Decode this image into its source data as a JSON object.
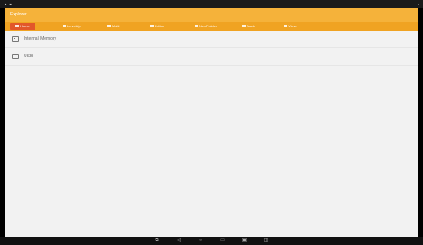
{
  "status": {
    "left_icons": "■ ■",
    "right_text": "▪"
  },
  "app": {
    "title": "Explorer"
  },
  "toolbar": {
    "items": [
      {
        "label": "Home",
        "icon": "home-icon"
      },
      {
        "label": "LevelUp",
        "icon": "levelup-icon"
      },
      {
        "label": "Multi",
        "icon": "multi-icon"
      },
      {
        "label": "Editor",
        "icon": "editor-icon"
      },
      {
        "label": "NewFolder",
        "icon": "newfolder-icon"
      },
      {
        "label": "Back",
        "icon": "back-icon"
      },
      {
        "label": "View",
        "icon": "view-icon"
      }
    ]
  },
  "list": {
    "items": [
      {
        "label": "Internal Memory",
        "icon": "disk-icon"
      },
      {
        "label": "USB",
        "icon": "usb-icon"
      }
    ]
  },
  "nav": {
    "buttons": [
      {
        "glyph": "⧉",
        "icon": "screenshot-icon"
      },
      {
        "glyph": "◁",
        "icon": "back-icon"
      },
      {
        "glyph": "○",
        "icon": "home-icon"
      },
      {
        "glyph": "□",
        "icon": "recents-icon"
      },
      {
        "glyph": "▣",
        "icon": "menu-icon"
      },
      {
        "glyph": "◫",
        "icon": "window-icon"
      }
    ]
  },
  "colors": {
    "header": "#f5b23a",
    "toolbar": "#f0a322",
    "active": "#e2572a"
  }
}
